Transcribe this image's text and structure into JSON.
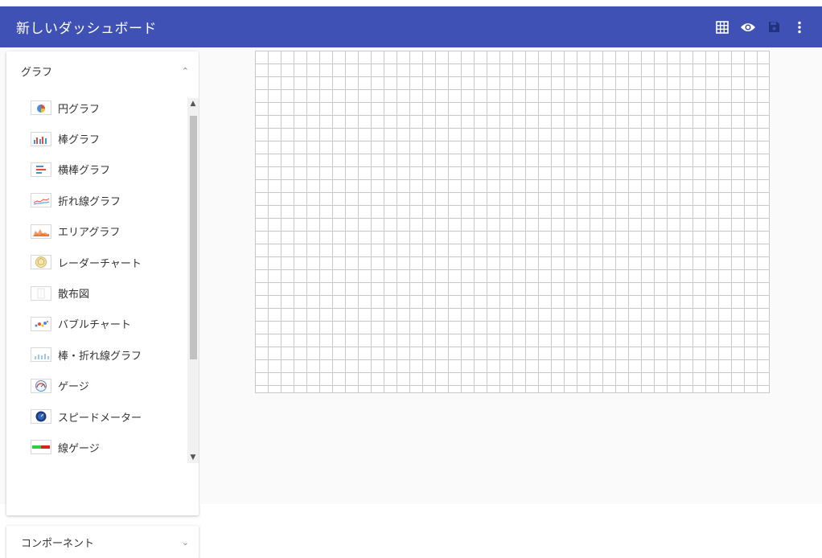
{
  "app": {
    "title": "新しいダッシュボード"
  },
  "toolbar": {
    "actions": [
      {
        "icon": "grid-icon"
      },
      {
        "icon": "eye-icon"
      },
      {
        "icon": "save-icon"
      },
      {
        "icon": "more-vert-icon"
      }
    ]
  },
  "sidebar": {
    "graph_section": {
      "title": "グラフ",
      "expanded": true,
      "items": [
        {
          "label": "円グラフ",
          "icon": "pie-chart-thumb"
        },
        {
          "label": "棒グラフ",
          "icon": "bar-chart-thumb"
        },
        {
          "label": "横棒グラフ",
          "icon": "hbar-chart-thumb"
        },
        {
          "label": "折れ線グラフ",
          "icon": "line-chart-thumb"
        },
        {
          "label": "エリアグラフ",
          "icon": "area-chart-thumb"
        },
        {
          "label": "レーダーチャート",
          "icon": "radar-chart-thumb"
        },
        {
          "label": "散布図",
          "icon": "scatter-chart-thumb"
        },
        {
          "label": "バブルチャート",
          "icon": "bubble-chart-thumb"
        },
        {
          "label": "棒・折れ線グラフ",
          "icon": "bar-line-chart-thumb"
        },
        {
          "label": "ゲージ",
          "icon": "gauge-thumb"
        },
        {
          "label": "スピードメーター",
          "icon": "speedometer-thumb"
        },
        {
          "label": "線ゲージ",
          "icon": "line-gauge-thumb"
        }
      ]
    },
    "component_section": {
      "title": "コンポーネント",
      "expanded": false
    }
  },
  "colors": {
    "appbar": "#3f51b5",
    "grid_line": "#c8c8c8"
  }
}
